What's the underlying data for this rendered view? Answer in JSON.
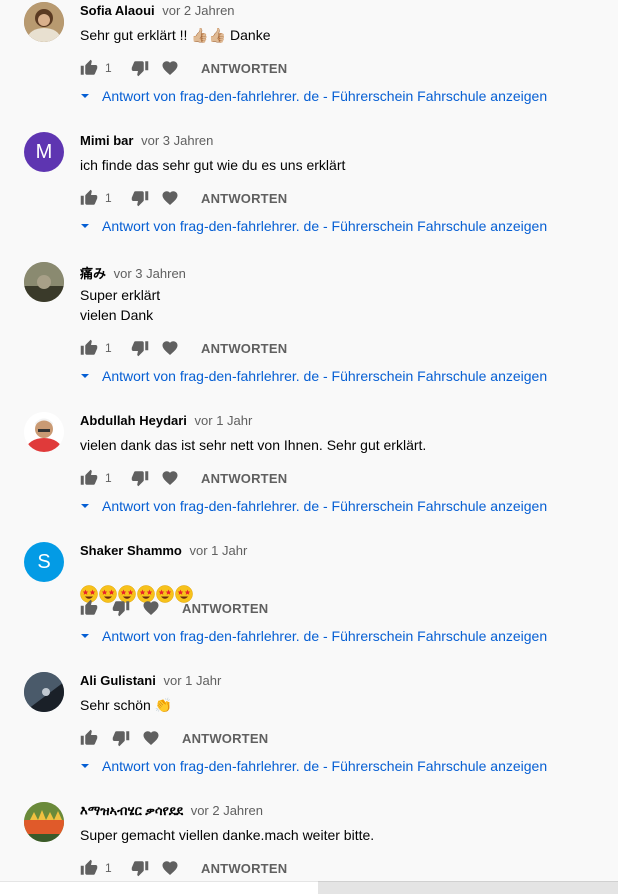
{
  "comments": [
    {
      "author": "Sofia Alaoui",
      "time": "vor 2 Jahren",
      "text": "Sehr gut erklärt !! 👍🏼👍🏼 Danke",
      "likes": "1",
      "reply_label": "ANTWORTEN",
      "replies_label": "Antwort von frag-den-fahrlehrer. de - Führerschein Fahrschule anzeigen",
      "avatar_color": "#8a6a4a"
    },
    {
      "author": "Mimi bar",
      "time": "vor 3 Jahren",
      "text": "ich finde das sehr gut wie du es uns erklärt",
      "likes": "1",
      "reply_label": "ANTWORTEN",
      "replies_label": "Antwort von frag-den-fahrlehrer. de - Führerschein Fahrschule anzeigen",
      "avatar_letter": "M",
      "avatar_color": "#5e35b1"
    },
    {
      "author": "痛み",
      "time": "vor 3 Jahren",
      "text": "Super erklärt\nvielen Dank",
      "likes": "1",
      "reply_label": "ANTWORTEN",
      "replies_label": "Antwort von frag-den-fahrlehrer. de - Führerschein Fahrschule anzeigen",
      "avatar_color": "#6b6b55"
    },
    {
      "author": "Abdullah Heydari",
      "time": "vor 1 Jahr",
      "text": "vielen dank das ist sehr nett von Ihnen.  Sehr gut erklärt.",
      "likes": "1",
      "reply_label": "ANTWORTEN",
      "replies_label": "Antwort von frag-den-fahrlehrer. de - Führerschein Fahrschule anzeigen",
      "avatar_color": "#e03a3a"
    },
    {
      "author": "Shaker Shammo",
      "time": "vor 1 Jahr",
      "text": "",
      "emoji_count": 6,
      "likes": "",
      "reply_label": "ANTWORTEN",
      "replies_label": "Antwort von frag-den-fahrlehrer. de - Führerschein Fahrschule anzeigen",
      "avatar_letter": "S",
      "avatar_color": "#039be5"
    },
    {
      "author": "Ali Gulistani",
      "time": "vor 1 Jahr",
      "text": "Sehr schön 👏",
      "likes": "",
      "reply_label": "ANTWORTEN",
      "replies_label": "Antwort von frag-den-fahrlehrer. de - Führerschein Fahrschule anzeigen",
      "avatar_color": "#2a3a4a"
    },
    {
      "author": "እማዝኣብሄር ቃሳየደደ",
      "time": "vor 2 Jahren",
      "text": "Super gemacht viellen danke.mach weiter bitte.",
      "likes": "1",
      "reply_label": "ANTWORTEN",
      "avatar_color": "#7a8a3a"
    }
  ],
  "colors": {
    "link_blue": "#065fd4",
    "icon_grey": "#606060",
    "background": "#f9f9f9"
  },
  "icons": {
    "like": "thumbs-up-icon",
    "dislike": "thumbs-down-icon",
    "heart": "heart-icon",
    "expand": "caret-down-icon"
  }
}
